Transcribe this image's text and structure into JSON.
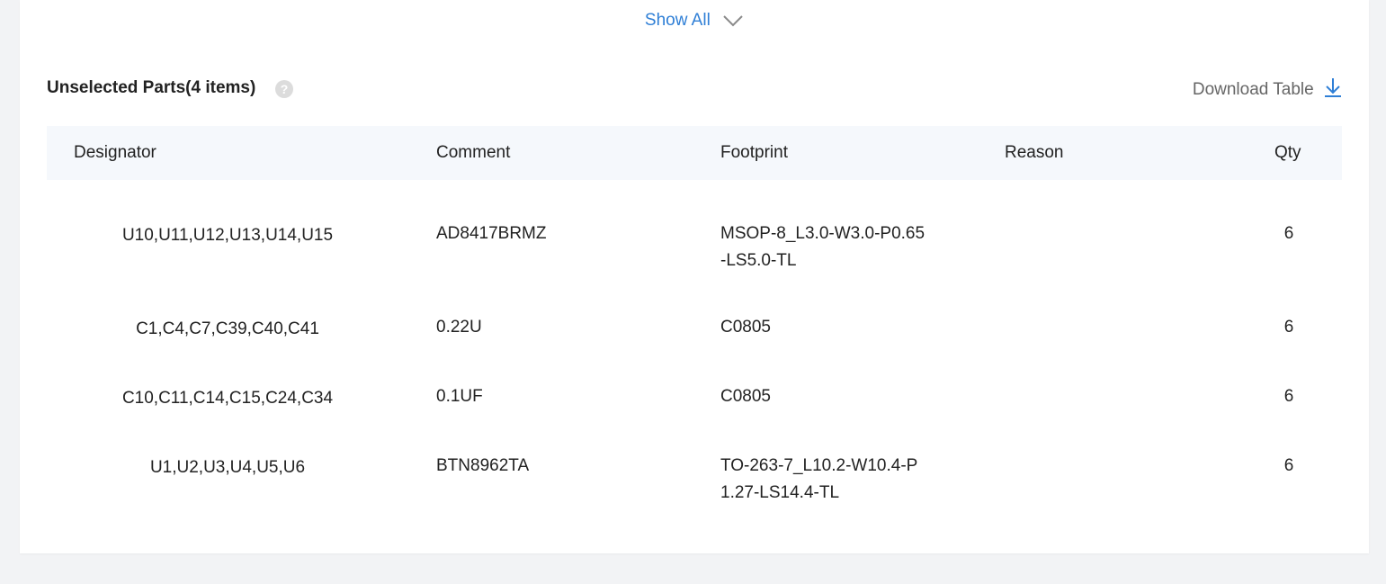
{
  "show_all": {
    "label": "Show All"
  },
  "section": {
    "title": "Unselected Parts(4 items)",
    "download_label": "Download Table"
  },
  "table": {
    "columns": [
      "Designator",
      "Comment",
      "Footprint",
      "Reason",
      "Qty"
    ],
    "rows": [
      {
        "designator": "U10,U11,U12,U13,U14,U15",
        "comment": "AD8417BRMZ",
        "footprint_line1": "MSOP-8_L3.0-W3.0-P0.65",
        "footprint_line2": "-LS5.0-TL",
        "reason": "",
        "qty": "6"
      },
      {
        "designator": "C1,C4,C7,C39,C40,C41",
        "comment": "0.22U",
        "footprint_line1": "C0805",
        "footprint_line2": "",
        "reason": "",
        "qty": "6"
      },
      {
        "designator": "C10,C11,C14,C15,C24,C34",
        "comment": "0.1UF",
        "footprint_line1": "C0805",
        "footprint_line2": "",
        "reason": "",
        "qty": "6"
      },
      {
        "designator": "U1,U2,U3,U4,U5,U6",
        "comment": "BTN8962TA",
        "footprint_line1": "TO-263-7_L10.2-W10.4-P",
        "footprint_line2": "1.27-LS14.4-TL",
        "reason": "",
        "qty": "6"
      }
    ]
  },
  "colors": {
    "accent": "#2f7fd6",
    "header_bg": "#f5f8fc",
    "page_bg": "#f2f3f5"
  },
  "icons": {
    "show_all": "chevron-down-icon",
    "help": "question-circle-icon",
    "download": "download-arrow-icon"
  }
}
